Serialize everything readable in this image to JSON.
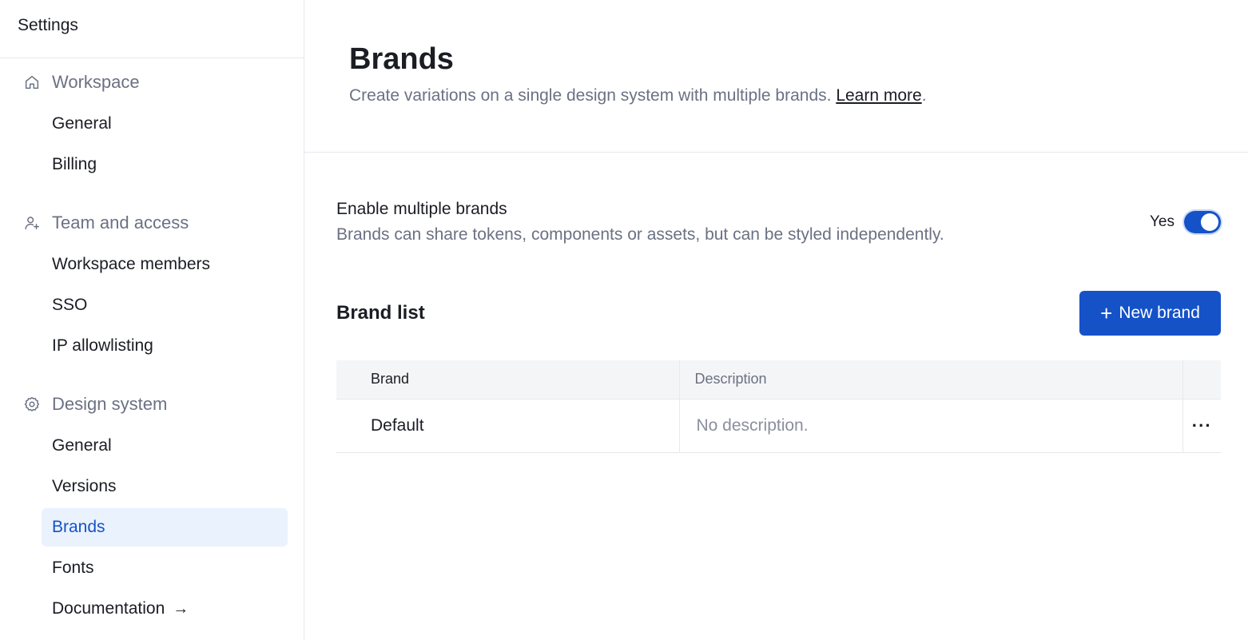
{
  "sidebar": {
    "title": "Settings",
    "sections": [
      {
        "label": "Workspace",
        "icon": "home-icon",
        "items": [
          "General",
          "Billing"
        ]
      },
      {
        "label": "Team and access",
        "icon": "user-add-icon",
        "items": [
          "Workspace members",
          "SSO",
          "IP allowlisting"
        ]
      },
      {
        "label": "Design system",
        "icon": "gear-icon",
        "items": [
          "General",
          "Versions",
          "Brands",
          "Fonts",
          "Documentation"
        ]
      }
    ],
    "active_item": "Brands",
    "external_arrow": "→"
  },
  "header": {
    "title": "Brands",
    "subtitle": "Create variations on a single design system with multiple brands.",
    "learn_more": "Learn more",
    "period": "."
  },
  "toggle": {
    "title": "Enable multiple brands",
    "description": "Brands can share tokens, components or assets, but can be styled independently.",
    "label": "Yes",
    "enabled": true
  },
  "brand_list": {
    "title": "Brand list",
    "new_button": "New brand",
    "new_button_icon": "+",
    "columns": [
      "Brand",
      "Description"
    ],
    "rows": [
      {
        "brand": "Default",
        "description": "No description.",
        "actions": "···"
      }
    ]
  },
  "colors": {
    "accent": "#1552c8",
    "active_bg": "#eaf2fd",
    "muted_text": "#6b7183",
    "border": "#e6e8ec"
  }
}
